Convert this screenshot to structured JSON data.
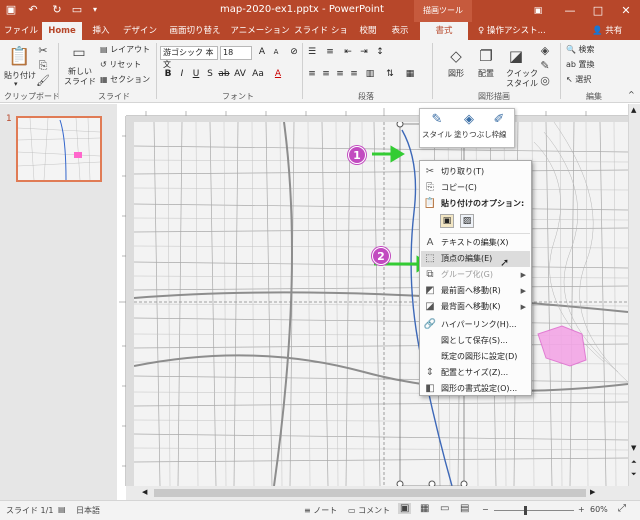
{
  "titlebar": {
    "title": "map-2020-ex1.pptx - PowerPoint",
    "context_tools": "描画ツール",
    "quick_access": [
      "save-icon",
      "undo-icon",
      "redo-icon",
      "present-icon"
    ],
    "min": "—",
    "max": "□",
    "close": "✕"
  },
  "tabs": {
    "items": [
      "ファイル",
      "Home",
      "挿入",
      "デザイン",
      "画面切り替え",
      "アニメーション",
      "スライド ショー",
      "校閲",
      "表示",
      "書式"
    ],
    "tell_me": "操作アシスト...",
    "share": "共有"
  },
  "ribbon": {
    "clipboard": {
      "paste": "貼り付け",
      "label": "クリップボード"
    },
    "slides": {
      "new_slide": "新しい",
      "new_slide2": "スライド",
      "layout": "レイアウト",
      "reset": "リセット",
      "section": "セクション",
      "label": "スライド"
    },
    "font": {
      "name": "游ゴシック 本文",
      "size": "18",
      "label": "フォント"
    },
    "paragraph": {
      "label": "段落"
    },
    "drawing": {
      "shapes": "図形",
      "arrange": "配置",
      "quick_styles": "クイック",
      "quick_styles2": "スタイル",
      "label": "図形描画"
    },
    "editing": {
      "find": "検索",
      "replace": "置換",
      "select": "選択",
      "label": "編集"
    }
  },
  "thumbnail": {
    "number": "1"
  },
  "minitoolbar": {
    "style": "スタイル",
    "fill": "塗りつぶし",
    "outline": "枠線"
  },
  "contextmenu": {
    "items": [
      {
        "label": "切り取り(T)",
        "icon": "scissors-icon"
      },
      {
        "label": "コピー(C)",
        "icon": "copy-icon"
      },
      {
        "label": "貼り付けのオプション:",
        "icon": "paste-icon"
      },
      {
        "label": "テキストの編集(X)",
        "icon": "text-edit-icon"
      },
      {
        "label": "頂点の編集(E)",
        "icon": "edit-points-icon"
      },
      {
        "label": "グループ化(G)",
        "icon": "group-icon"
      },
      {
        "label": "最前面へ移動(R)",
        "icon": "bring-front-icon"
      },
      {
        "label": "最背面へ移動(K)",
        "icon": "send-back-icon"
      },
      {
        "label": "ハイパーリンク(H)...",
        "icon": "hyperlink-icon"
      },
      {
        "label": "図として保存(S)...",
        "icon": ""
      },
      {
        "label": "既定の図形に設定(D)",
        "icon": ""
      },
      {
        "label": "配置とサイズ(Z)...",
        "icon": "size-icon"
      },
      {
        "label": "図形の書式設定(O)...",
        "icon": "format-shape-icon"
      }
    ]
  },
  "badges": {
    "one": "1",
    "two": "2"
  },
  "statusbar": {
    "slide": "スライド 1/1",
    "language": "日本語",
    "notes": "ノート",
    "comments": "コメント",
    "zoom": "60%"
  },
  "colors": {
    "accent": "#b7472a",
    "badge": "#c24bc0",
    "arrow": "#33cc33"
  }
}
